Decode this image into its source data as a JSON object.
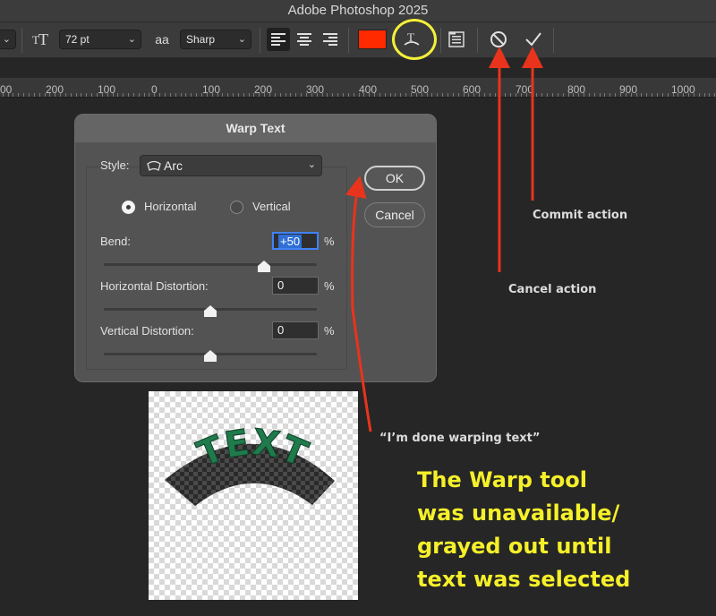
{
  "app": {
    "title": "Adobe Photoshop 2025"
  },
  "options_bar": {
    "font_size": "72 pt",
    "antialias_icon_text": "aa",
    "antialias_value": "Sharp",
    "text_color": "#ff2a00",
    "icons": [
      "text-orientation-icon",
      "font-size-icon",
      "antialias-icon",
      "align-left-icon",
      "align-center-icon",
      "align-right-icon",
      "warp-text-icon",
      "character-panel-icon",
      "cancel-icon",
      "commit-icon"
    ]
  },
  "ruler": {
    "ticks": [
      "00",
      "200",
      "100",
      "0",
      "100",
      "200",
      "300",
      "400",
      "500",
      "600",
      "700",
      "800",
      "900",
      "1000"
    ]
  },
  "dialog": {
    "title": "Warp Text",
    "style_label": "Style:",
    "style_value": "Arc",
    "orientation": {
      "horizontal_label": "Horizontal",
      "vertical_label": "Vertical",
      "selected": "Horizontal"
    },
    "bend": {
      "label": "Bend:",
      "value": "+50",
      "unit": "%",
      "slider_fraction": 0.75
    },
    "horizontal_distortion": {
      "label": "Horizontal Distortion:",
      "value": "0",
      "unit": "%",
      "slider_fraction": 0.5
    },
    "vertical_distortion": {
      "label": "Vertical Distortion:",
      "value": "0",
      "unit": "%",
      "slider_fraction": 0.5
    },
    "ok_label": "OK",
    "cancel_label": "Cancel"
  },
  "canvas": {
    "text": "TEXT",
    "text_color": "#1f7a4c"
  },
  "annotations": {
    "commit": "Commit action",
    "cancel": "Cancel action",
    "done": "“I’m done warping text”",
    "note_lines": [
      "The Warp tool",
      "was unavailable/",
      "grayed out until",
      "text was selected"
    ],
    "arrow_color": "#e8341c",
    "highlight_color": "#f4f03a",
    "note_color": "#f5f02a"
  }
}
